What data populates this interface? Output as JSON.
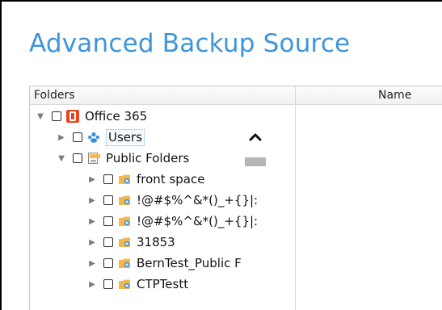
{
  "title": "Advanced Backup Source",
  "columns": {
    "folders": "Folders",
    "name": "Name"
  },
  "tree": [
    {
      "label": "Office 365",
      "expanded": true,
      "icon": "office365-icon",
      "depth": 0
    },
    {
      "label": "Users",
      "expanded": false,
      "icon": "users-icon",
      "depth": 1,
      "selected": true
    },
    {
      "label": "Public Folders",
      "expanded": true,
      "icon": "public-folders-icon",
      "depth": 1
    },
    {
      "label": "front space",
      "expanded": false,
      "icon": "folder-icon",
      "depth": 2
    },
    {
      "label": "!@#$%^&*()_+{}|:",
      "expanded": false,
      "icon": "folder-icon",
      "depth": 2
    },
    {
      "label": "!@#$%^&*()_+{}|:",
      "expanded": false,
      "icon": "folder-icon",
      "depth": 2
    },
    {
      "label": "31853",
      "expanded": false,
      "icon": "folder-icon",
      "depth": 2
    },
    {
      "label": "BernTest_Public F",
      "expanded": false,
      "icon": "folder-icon",
      "depth": 2
    },
    {
      "label": "CTPTestt",
      "expanded": false,
      "icon": "folder-icon",
      "depth": 2
    }
  ],
  "colors": {
    "title": "#3f95d8",
    "office": "#e8461f",
    "users": "#3f8fd8",
    "folder": "#f2b84b"
  }
}
